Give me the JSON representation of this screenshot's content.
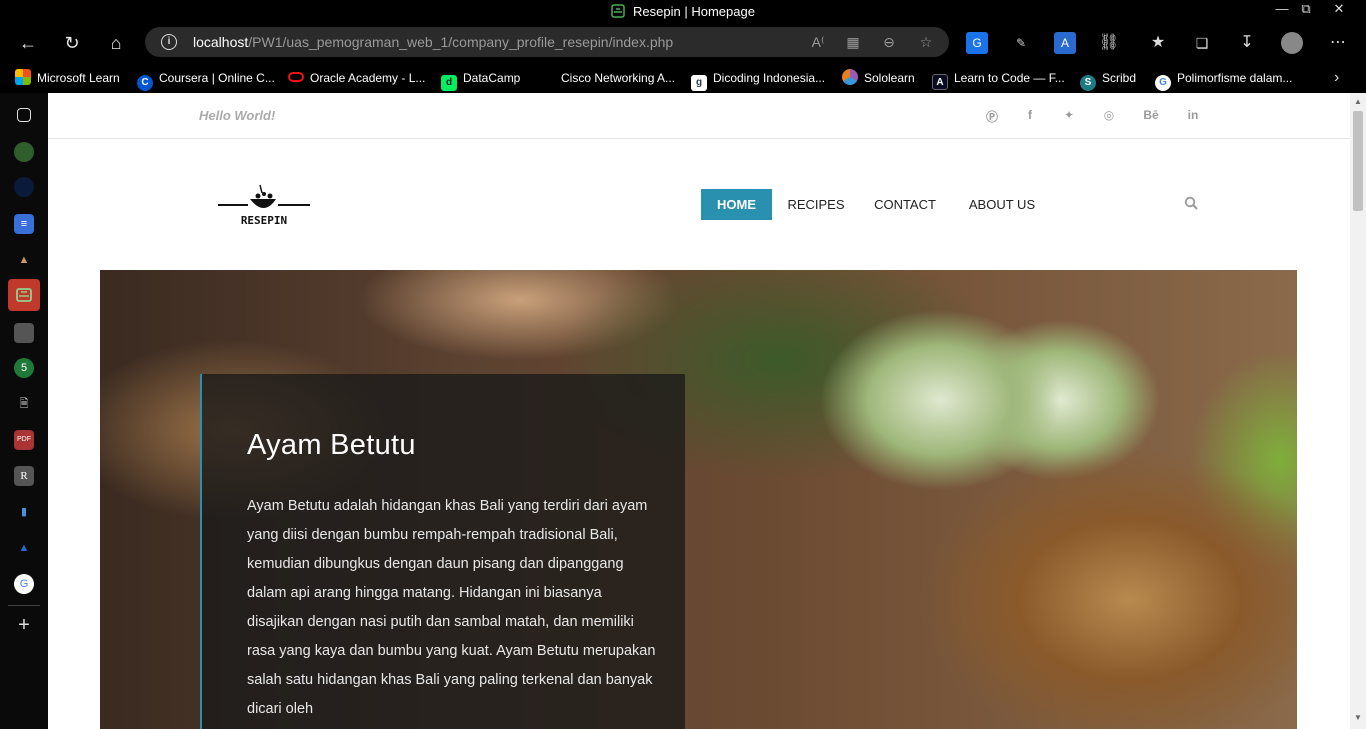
{
  "window": {
    "title": "Resepin | Homepage",
    "controls": [
      "minimize",
      "restore",
      "close"
    ]
  },
  "toolbar": {
    "url_host": "localhost",
    "url_path": "/PW1/uas_pemograman_web_1/company_profile_resepin/index.php"
  },
  "bookmarks": [
    {
      "label": "Microsoft Learn",
      "icon": "microsoft-logo-icon",
      "color": "#f25022"
    },
    {
      "label": "Coursera | Online C...",
      "icon": "coursera-icon",
      "color": "#0056d2"
    },
    {
      "label": "Oracle Academy - L...",
      "icon": "oracle-icon",
      "color": "#e11"
    },
    {
      "label": "DataCamp",
      "icon": "datacamp-icon",
      "color": "#03ef62"
    },
    {
      "label": "Cisco Networking A...",
      "icon": "cisco-icon",
      "color": "#000"
    },
    {
      "label": "Dicoding Indonesia...",
      "icon": "dicoding-icon",
      "color": "#2d3e50"
    },
    {
      "label": "Sololearn",
      "icon": "sololearn-icon",
      "color": "#9b59b6"
    },
    {
      "label": "Learn to Code — F...",
      "icon": "freecodecamp-icon",
      "color": "#0a0a23"
    },
    {
      "label": "Scribd",
      "icon": "scribd-icon",
      "color": "#1e7b85"
    },
    {
      "label": "Polimorfisme dalam...",
      "icon": "google-icon",
      "color": "#4285f4"
    }
  ],
  "site": {
    "tagline": "Hello World!",
    "social": [
      "P",
      "f",
      "t",
      "◎",
      "Bē",
      "in"
    ],
    "logo_text": "RESEPIN",
    "nav": [
      {
        "label": "HOME",
        "active": true
      },
      {
        "label": "RECIPES",
        "active": false
      },
      {
        "label": "CONTACT",
        "active": false
      },
      {
        "label": "ABOUT US",
        "active": false
      }
    ],
    "accent_color": "#2a90b0"
  },
  "hero": {
    "title": "Ayam Betutu",
    "description": "Ayam Betutu adalah hidangan khas Bali yang terdiri dari ayam yang diisi dengan bumbu rempah-rempah tradisional Bali, kemudian dibungkus dengan daun pisang dan dipanggang dalam api arang hingga matang. Hidangan ini biasanya disajikan dengan nasi putih dan sambal matah, dan memiliki rasa yang kaya dan bumbu yang kuat. Ayam Betutu merupakan salah satu hidangan khas Bali yang paling terkenal dan banyak dicari oleh"
  }
}
